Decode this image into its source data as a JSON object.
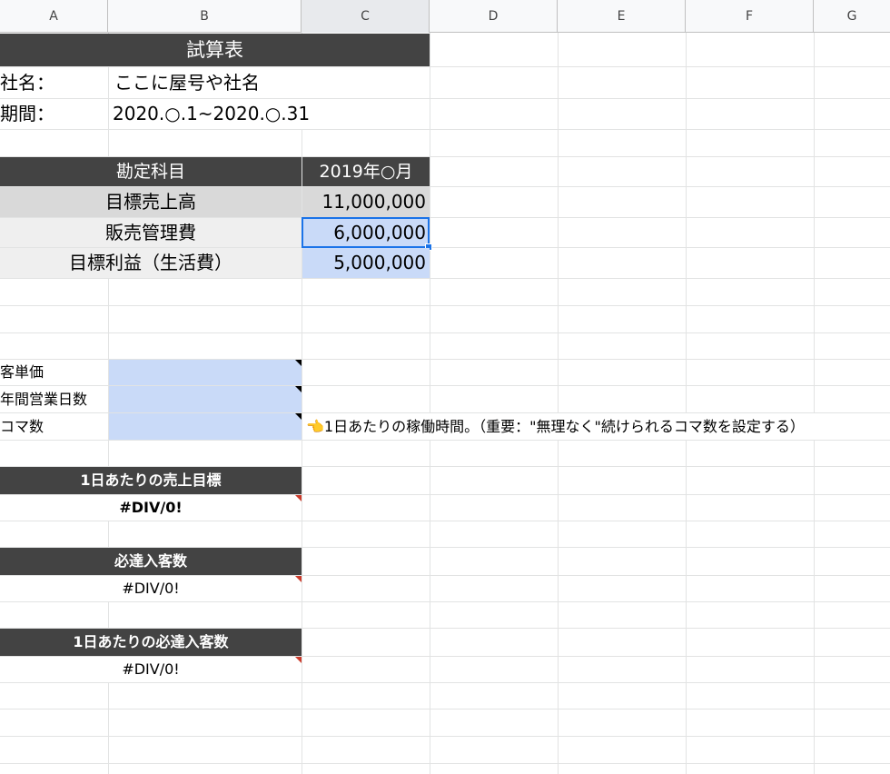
{
  "columns": [
    "A",
    "B",
    "C",
    "D",
    "E",
    "F",
    "G"
  ],
  "title": "試算表",
  "company": {
    "label": "社名：",
    "value": "ここに屋号や社名"
  },
  "period": {
    "label": "期間：",
    "value": "2020.○.1~2020.○.31"
  },
  "budget_table": {
    "header_item": "勘定科目",
    "header_month": "2019年○月",
    "rows": [
      {
        "label": "目標売上高",
        "value": "11,000,000"
      },
      {
        "label": "販売管理費",
        "value": "6,000,000"
      },
      {
        "label": "目標利益（生活費）",
        "value": "5,000,000"
      }
    ]
  },
  "inputs": [
    {
      "label": "客単価"
    },
    {
      "label": "年間営業日数"
    },
    {
      "label": "コマ数"
    }
  ],
  "koma_note": "👈1日あたりの稼働時間。（重要：\"無理なく\"続けられるコマ数を設定する）",
  "results": [
    {
      "header": "1日あたりの売上目標",
      "value": "#DIV/0!"
    },
    {
      "header": "必達入客数",
      "value": "#DIV/0!"
    },
    {
      "header": "1日あたりの必達入客数",
      "value": "#DIV/0!"
    }
  ],
  "colors": {
    "header_dark": "#434343",
    "input_blue": "#c9daf8",
    "selection": "#1a73e8",
    "comment_red": "#cc3b2b"
  }
}
